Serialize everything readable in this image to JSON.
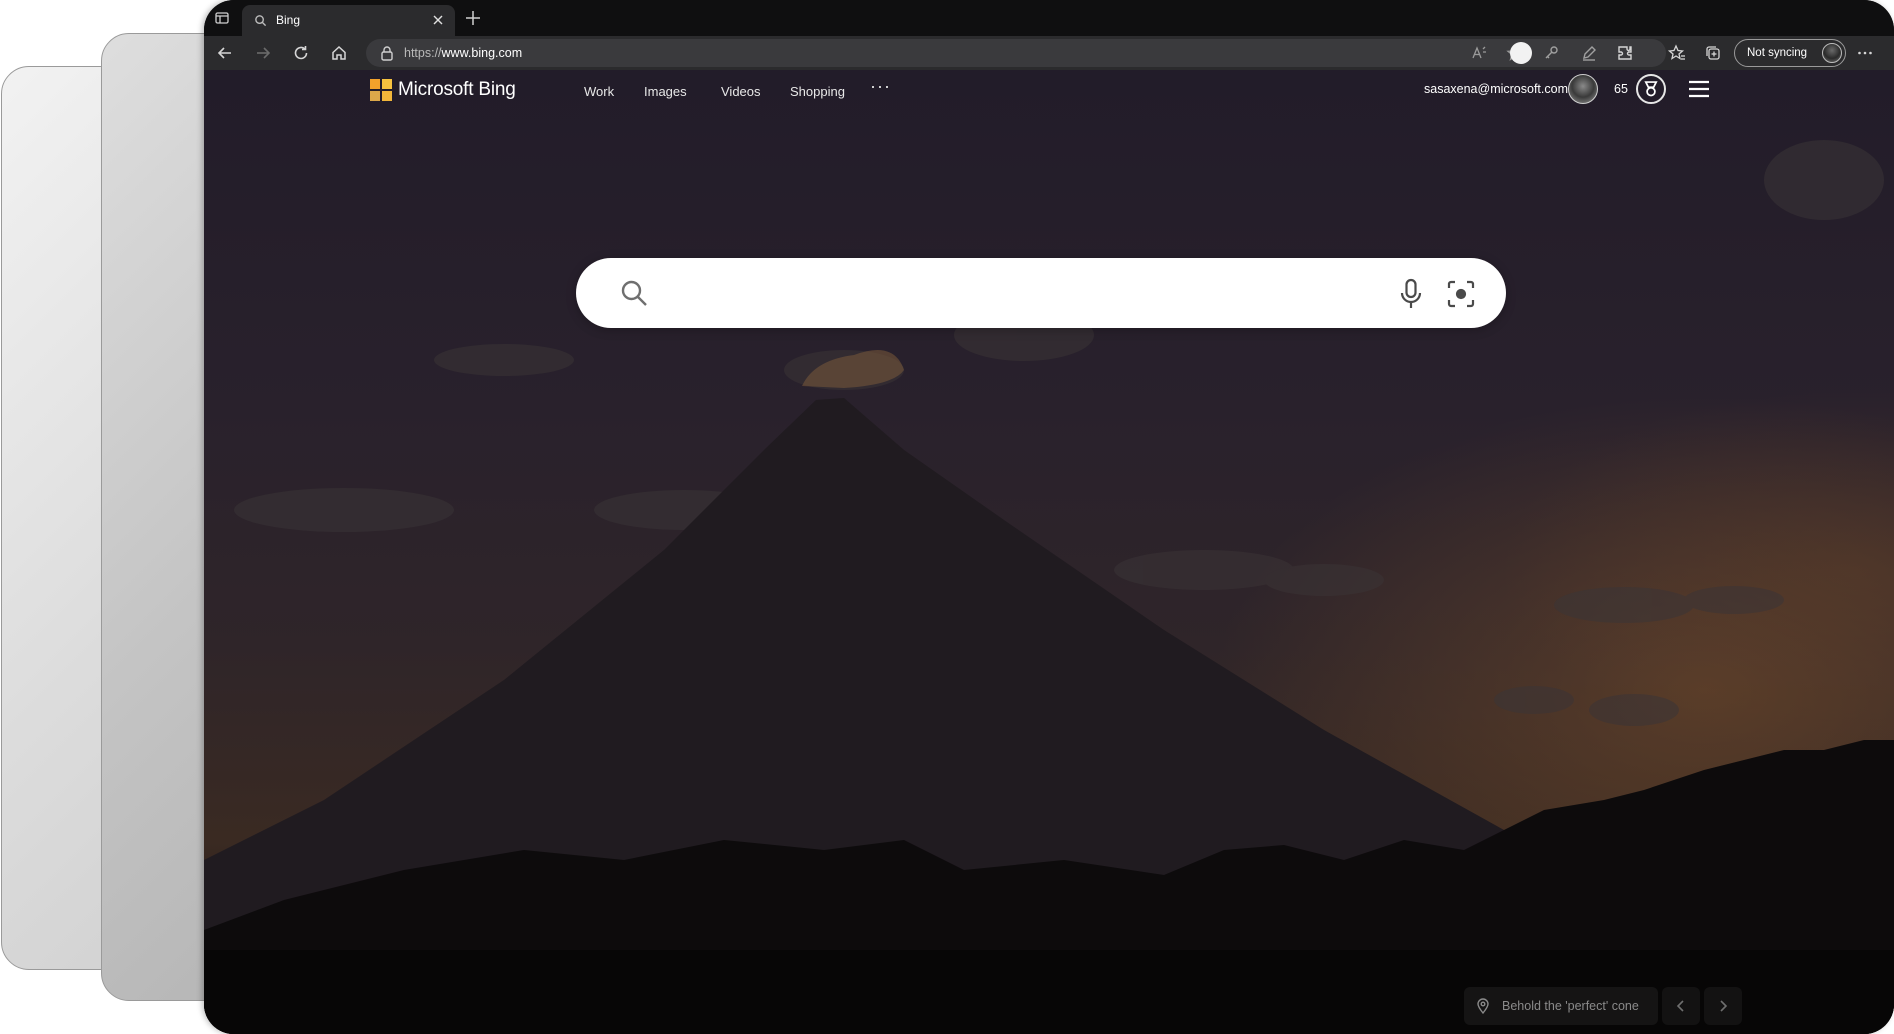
{
  "browser": {
    "tab": {
      "title": "Bing"
    },
    "address": {
      "scheme": "https://",
      "host": "www.bing.com"
    },
    "sync_label": "Not syncing"
  },
  "header": {
    "brand": "Microsoft Bing",
    "nav": [
      "Work",
      "Images",
      "Videos",
      "Shopping"
    ],
    "more": "···",
    "user_email": "sasaxena@microsoft.com",
    "reward_points": "65"
  },
  "search": {
    "placeholder": ""
  },
  "caption": {
    "text": "Behold the 'perfect' cone"
  },
  "colors": {
    "logo_tiles": [
      "#f2a12b",
      "#f7c23f",
      "#dca84a",
      "#f2b63a"
    ]
  }
}
